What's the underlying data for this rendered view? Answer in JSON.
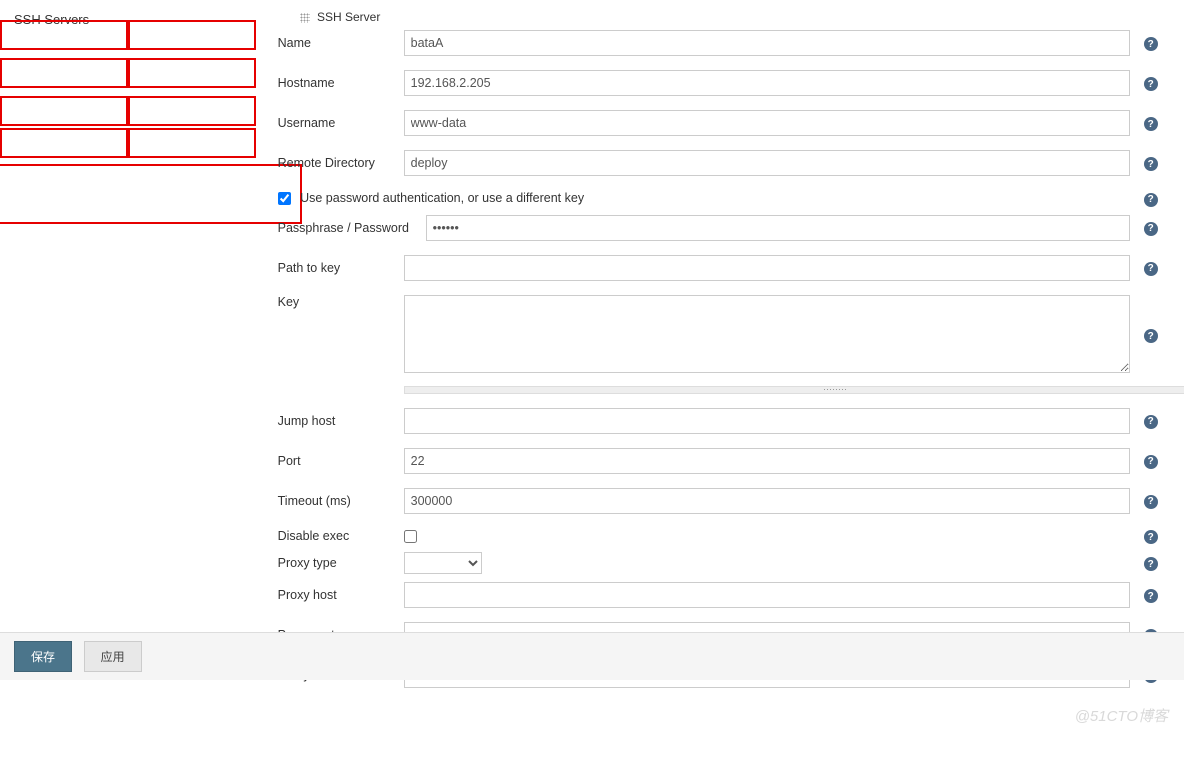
{
  "section": {
    "title": "SSH Servers",
    "legend": "SSH Server"
  },
  "fields": {
    "name": {
      "label": "Name",
      "value": "bataA"
    },
    "hostname": {
      "label": "Hostname",
      "value": "192.168.2.205"
    },
    "username": {
      "label": "Username",
      "value": "www-data"
    },
    "remotedir": {
      "label": "Remote Directory",
      "value": "deploy"
    },
    "usepass": {
      "label": "Use password authentication, or use a different key",
      "checked": true
    },
    "password": {
      "label": "Passphrase / Password",
      "value": "••••••"
    },
    "pathkey": {
      "label": "Path to key",
      "value": ""
    },
    "key": {
      "label": "Key",
      "value": ""
    },
    "jumphost": {
      "label": "Jump host",
      "value": ""
    },
    "port": {
      "label": "Port",
      "value": "22"
    },
    "timeout": {
      "label": "Timeout (ms)",
      "value": "300000"
    },
    "disexec": {
      "label": "Disable exec",
      "checked": false
    },
    "proxytype": {
      "label": "Proxy type",
      "value": ""
    },
    "proxyhost": {
      "label": "Proxy host",
      "value": ""
    },
    "proxyport": {
      "label": "Proxy port",
      "value": ""
    },
    "proxyuser": {
      "label": "Proxy user",
      "value": ""
    }
  },
  "buttons": {
    "save": "保存",
    "apply": "应用"
  },
  "watermark": "@51CTO博客"
}
